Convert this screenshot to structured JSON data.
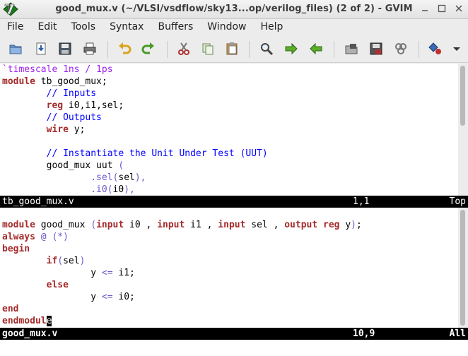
{
  "window": {
    "title": "good_mux.v (~/VLSI/vsdflow/sky13...op/verilog_files) (2 of 2) - GVIM",
    "buttons": [
      "minimize-icon",
      "maximize-icon",
      "close-icon"
    ]
  },
  "menubar": [
    "File",
    "Edit",
    "Tools",
    "Syntax",
    "Buffers",
    "Window",
    "Help"
  ],
  "toolbar": [
    "open-folder-icon",
    "save-download-icon",
    "save-icon",
    "print-icon",
    "undo-icon",
    "redo-icon",
    "cut-icon",
    "copy-icon",
    "paste-icon",
    "find-icon",
    "find-next-icon",
    "find-prev-icon",
    "load-session-icon",
    "save-session-icon",
    "run-script-icon",
    "make-icon",
    "toolbar-overflow-icon"
  ],
  "pane1": {
    "lines": [
      "`timescale 1ns / 1ps",
      "module tb_good_mux;",
      "        // Inputs",
      "        reg i0,i1,sel;",
      "        // Outputs",
      "        wire y;",
      "",
      "        // Instantiate the Unit Under Test (UUT)",
      "        good_mux uut (",
      "                .sel(sel),",
      "                .i0(i0),"
    ],
    "status": {
      "file": "tb_good_mux.v",
      "position": "1,1",
      "percent": "Top"
    }
  },
  "pane2": {
    "lines": [
      "module good_mux (input i0 , input i1 , input sel , output reg y);",
      "always @ (*)",
      "begin",
      "        if(sel)",
      "                y <= i1;",
      "        else",
      "                y <= i0;",
      "end",
      "endmodule"
    ],
    "status": {
      "file": "good_mux.v",
      "position": "10,9",
      "percent": "All"
    }
  },
  "colors": {
    "keyword": "#a52a2a",
    "comment": "#0000ff",
    "preproc": "#a020f0",
    "special": "#6a5acd",
    "statusline_bg": "#000000"
  }
}
